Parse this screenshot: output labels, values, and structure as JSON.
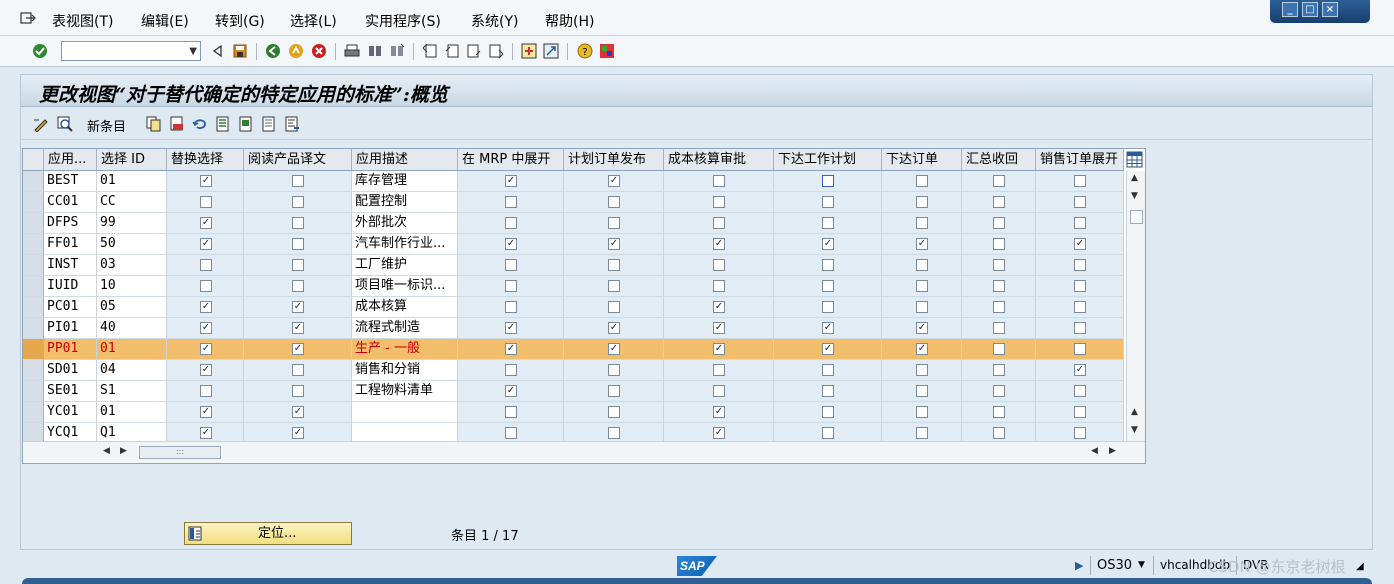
{
  "menu": {
    "items": [
      "表视图(T)",
      "编辑(E)",
      "转到(G)",
      "选择(L)",
      "实用程序(S)",
      "系统(Y)",
      "帮助(H)"
    ]
  },
  "window_controls": {
    "minimize": "_",
    "maximize": "□",
    "close": "×"
  },
  "toolbar": {
    "command_value": ""
  },
  "page": {
    "title": "更改视图“对于替代确定的特定应用的标准”:概览",
    "new_entries": "新条目"
  },
  "table": {
    "headers": [
      "应用...",
      "选择 ID",
      "替换选择",
      "阅读产品译文",
      "应用描述",
      "在 MRP 中展开",
      "计划订单发布",
      "成本核算审批",
      "下达工作计划",
      "下达订单",
      "汇总收回",
      "销售订单展开"
    ],
    "rows": [
      {
        "app": "BEST",
        "sel_id": "01",
        "desc": "库存管理",
        "c": [
          1,
          0,
          1,
          1,
          0,
          0,
          0,
          0,
          0
        ]
      },
      {
        "app": "CC01",
        "sel_id": "CC",
        "desc": "配置控制",
        "c": [
          0,
          0,
          0,
          0,
          0,
          0,
          0,
          0,
          0
        ]
      },
      {
        "app": "DFPS",
        "sel_id": "99",
        "desc": "外部批次",
        "c": [
          1,
          0,
          0,
          0,
          0,
          0,
          0,
          0,
          0
        ]
      },
      {
        "app": "FF01",
        "sel_id": "50",
        "desc": "汽车制作行业...",
        "c": [
          1,
          0,
          1,
          1,
          1,
          1,
          1,
          0,
          1
        ]
      },
      {
        "app": "INST",
        "sel_id": "03",
        "desc": "工厂维护",
        "c": [
          0,
          0,
          0,
          0,
          0,
          0,
          0,
          0,
          0
        ]
      },
      {
        "app": "IUID",
        "sel_id": "10",
        "desc": "项目唯一标识...",
        "c": [
          0,
          0,
          0,
          0,
          0,
          0,
          0,
          0,
          0
        ]
      },
      {
        "app": "PC01",
        "sel_id": "05",
        "desc": "成本核算",
        "c": [
          1,
          1,
          0,
          0,
          1,
          0,
          0,
          0,
          0
        ]
      },
      {
        "app": "PI01",
        "sel_id": "40",
        "desc": "流程式制造",
        "c": [
          1,
          1,
          1,
          1,
          1,
          1,
          1,
          0,
          0
        ]
      },
      {
        "app": "PP01",
        "sel_id": "01",
        "desc": "生产 - 一般",
        "c": [
          1,
          1,
          1,
          1,
          1,
          1,
          1,
          0,
          0
        ]
      },
      {
        "app": "SD01",
        "sel_id": "04",
        "desc": "销售和分销",
        "c": [
          1,
          0,
          0,
          0,
          0,
          0,
          0,
          0,
          1
        ]
      },
      {
        "app": "SE01",
        "sel_id": "S1",
        "desc": "工程物料清单",
        "c": [
          0,
          0,
          1,
          0,
          0,
          0,
          0,
          0,
          0
        ]
      },
      {
        "app": "YC01",
        "sel_id": "01",
        "desc": "",
        "c": [
          1,
          1,
          0,
          0,
          1,
          0,
          0,
          0,
          0
        ]
      },
      {
        "app": "YCQ1",
        "sel_id": "Q1",
        "desc": "",
        "c": [
          1,
          1,
          0,
          0,
          1,
          0,
          0,
          0,
          0
        ]
      }
    ]
  },
  "footer": {
    "locate_label": "定位...",
    "entry_info": "条目 1 / 17"
  },
  "status": {
    "logo": "SAP",
    "tcode": "OS30",
    "server": "vhcalhdbdb",
    "client": "DVR",
    "watermark": "CSDN @东京老树根"
  },
  "colors": {
    "highlight_row": "#f2be6c",
    "highlight_text": "#c8000a",
    "background": "#dfe9f1"
  }
}
